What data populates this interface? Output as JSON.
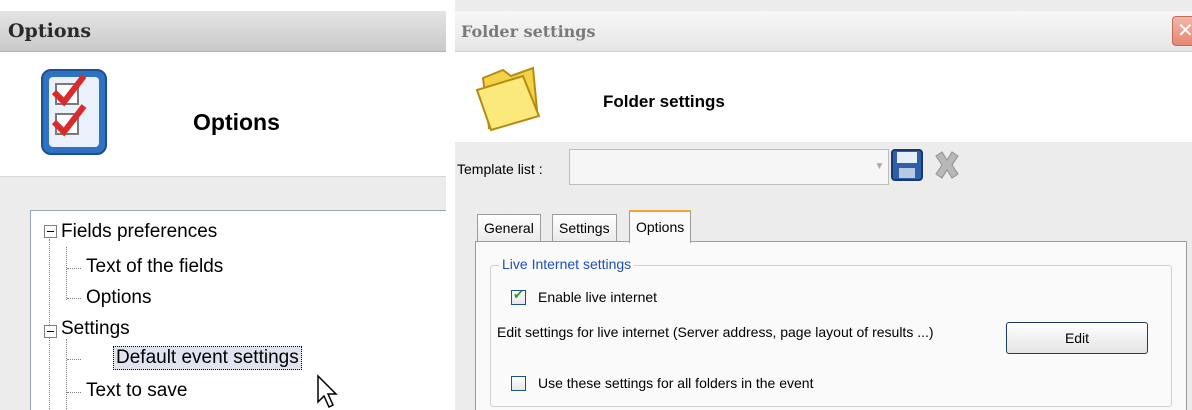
{
  "options_window": {
    "title": "Options",
    "heading": "Options",
    "tree": [
      {
        "label": "Fields preferences",
        "level": 0,
        "expanded": true
      },
      {
        "label": "Text of the fields",
        "level": 1
      },
      {
        "label": "Options",
        "level": 1
      },
      {
        "label": "Settings",
        "level": 0,
        "expanded": true
      },
      {
        "label": "Default event settings",
        "level": 1,
        "selected": true
      },
      {
        "label": "Text to save",
        "level": 1
      }
    ]
  },
  "folder_window": {
    "title": "Folder settings",
    "heading": "Folder settings",
    "template_list": {
      "label": "Template list :",
      "value": ""
    },
    "toolbar_icons": [
      "save-icon",
      "delete-icon"
    ],
    "tabs": [
      {
        "label": "General",
        "active": false
      },
      {
        "label": "Settings",
        "active": false
      },
      {
        "label": "Options",
        "active": true
      }
    ],
    "group": {
      "title": "Live Internet settings",
      "enable_label": "Enable live internet",
      "enable_checked": true,
      "edit_description": "Edit settings for live internet (Server address, page layout of results ...)",
      "edit_button": "Edit",
      "all_folders_label": "Use these settings for all folders in the event",
      "all_folders_checked": false
    }
  },
  "colors": {
    "accent_tab": "#f2a430",
    "group_title": "#1f4fbf",
    "close_button": "#e58872"
  }
}
